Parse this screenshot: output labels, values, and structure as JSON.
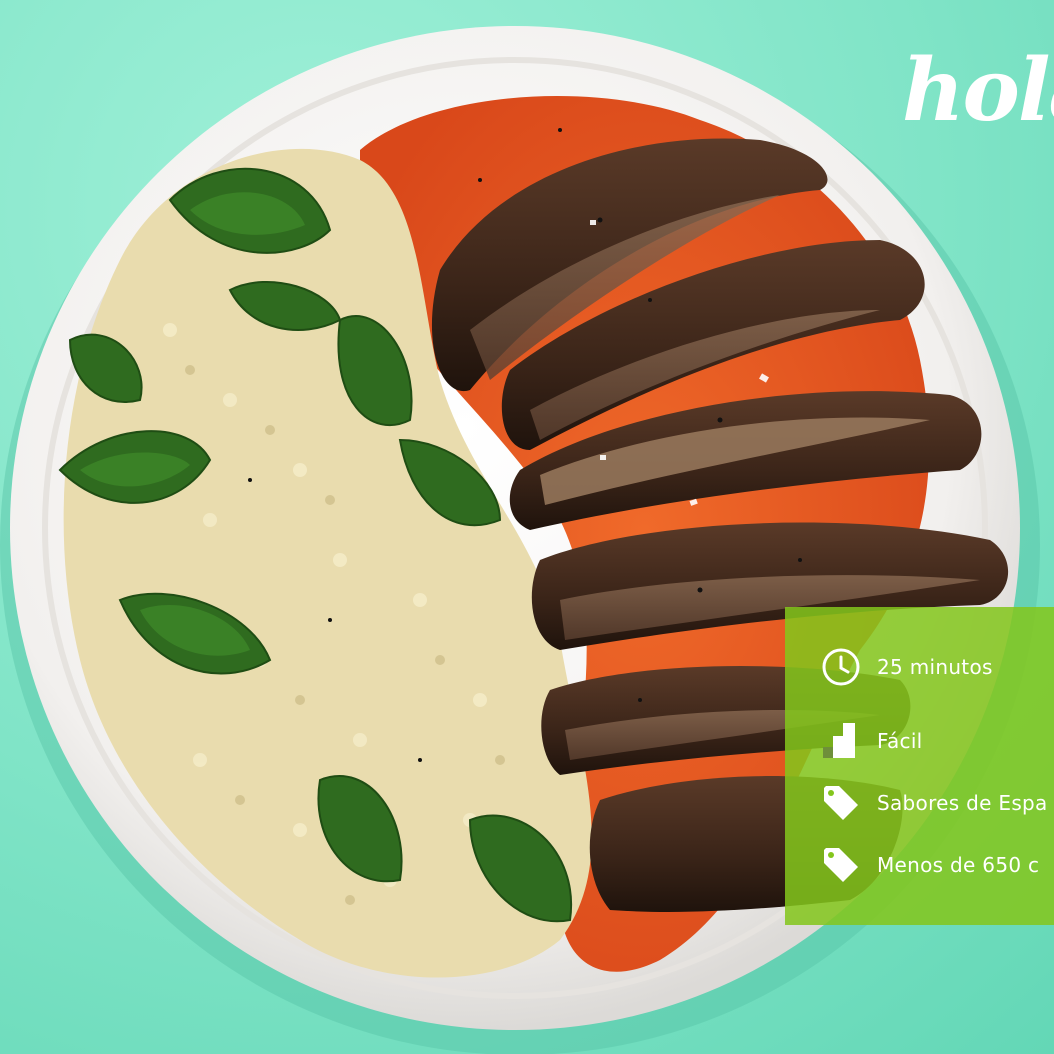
{
  "brand": {
    "logo_text": "hola",
    "background_color": "#7fe3c6",
    "panel_color": "#84c61c"
  },
  "photo": {
    "icon": "food-photo"
  },
  "recipe_info": {
    "items": [
      {
        "icon": "clock-icon",
        "label": "25 minutos"
      },
      {
        "icon": "difficulty-bars-icon",
        "label": "Fácil"
      },
      {
        "icon": "tag-icon",
        "label": "Sabores de Espa"
      },
      {
        "icon": "tag-icon",
        "label": "Menos de 650 c"
      }
    ]
  }
}
